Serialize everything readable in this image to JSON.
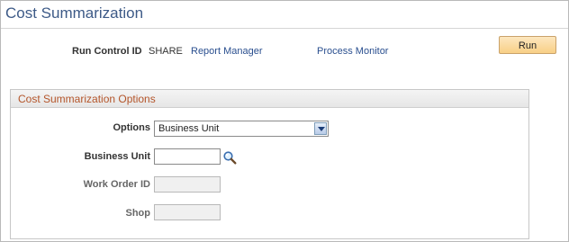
{
  "page": {
    "title": "Cost Summarization"
  },
  "run_control": {
    "label": "Run Control ID",
    "value": "SHARE",
    "report_manager_link": "Report Manager",
    "process_monitor_link": "Process Monitor",
    "run_button": "Run"
  },
  "options_group": {
    "title": "Cost Summarization Options",
    "options_label": "Options",
    "options_selected": "Business Unit",
    "business_unit_label": "Business Unit",
    "business_unit_value": "",
    "work_order_label": "Work Order ID",
    "work_order_value": "",
    "shop_label": "Shop",
    "shop_value": ""
  },
  "icons": {
    "lookup": "magnifier-icon",
    "dropdown": "chevron-down-icon"
  },
  "colors": {
    "title": "#3d5a87",
    "link": "#2a4f8f",
    "group_title": "#b4552a",
    "run_button": "#f8cf86"
  }
}
